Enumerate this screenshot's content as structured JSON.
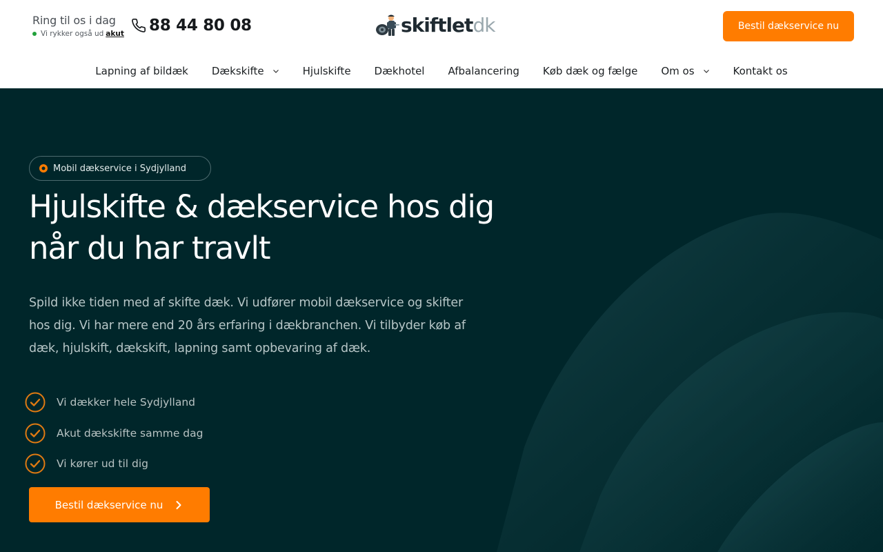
{
  "header": {
    "call_title": "Ring til os i dag",
    "call_sub": "Vi rykker også ud",
    "akut_link": "akut",
    "phone_number": "88 44 80 08",
    "phone_icon": "phone-icon",
    "logo": {
      "part1": "skiftlet",
      "part2": "dk"
    },
    "cta_label": "Bestil dækservice nu"
  },
  "nav": {
    "items": [
      {
        "label": "Lapning af bildæk",
        "has_dropdown": false
      },
      {
        "label": "Dækskifte",
        "has_dropdown": true
      },
      {
        "label": "Hjulskifte",
        "has_dropdown": false
      },
      {
        "label": "Dækhotel",
        "has_dropdown": false
      },
      {
        "label": "Afbalancering",
        "has_dropdown": false
      },
      {
        "label": "Køb dæk og fælge",
        "has_dropdown": false
      },
      {
        "label": "Om os",
        "has_dropdown": true
      },
      {
        "label": "Kontakt os",
        "has_dropdown": false
      }
    ]
  },
  "hero": {
    "badge": "Mobil dækservice i Sydjylland",
    "title_line1": "Hjulskifte & dækservice hos dig",
    "title_line2": "når du har travlt",
    "text": "Spild ikke tiden med af skifte dæk. Vi udfører mobil dækservice og skifter hos dig. Vi har mere end 20 års erfaring i dækbranchen. Vi tilbyder køb af dæk, hjulskift, dækskift, lapning samt opbevaring af dæk.",
    "features": [
      "Vi dækker hele Sydjylland",
      "Akut dækskifte samme dag",
      "Vi kører ud til dig"
    ],
    "cta_label": "Bestil dækservice nu"
  },
  "colors": {
    "accent": "#ff7c00",
    "hero_bg": "#00262a",
    "status_dot": "#22a13b"
  }
}
